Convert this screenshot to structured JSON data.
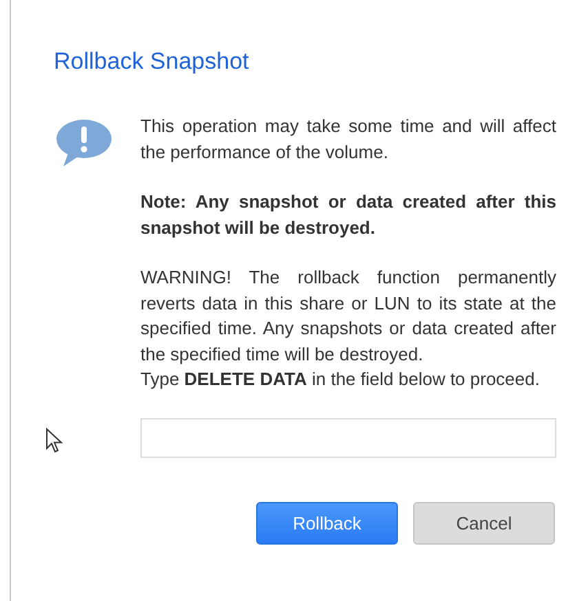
{
  "dialog": {
    "title": "Rollback Snapshot",
    "paragraphs": [
      {
        "kind": "normal",
        "text": "This operation may take some time and will affect the performance of the volume."
      },
      {
        "kind": "bold",
        "text": "Note: Any snapshot or data created after this snapshot will be destroyed."
      },
      {
        "kind": "normal",
        "text": "WARNING! The rollback function permanently reverts data in this share or LUN to its state at the specified time. Any snapshots or data created after the specified time will be destroyed."
      },
      {
        "kind": "attached",
        "text": "Type **DELETE DATA** in the field below to proceed."
      }
    ],
    "buttons": [
      {
        "label": "Rollback",
        "kind": "primary"
      },
      {
        "label": "Cancel",
        "kind": "secondary"
      }
    ]
  }
}
